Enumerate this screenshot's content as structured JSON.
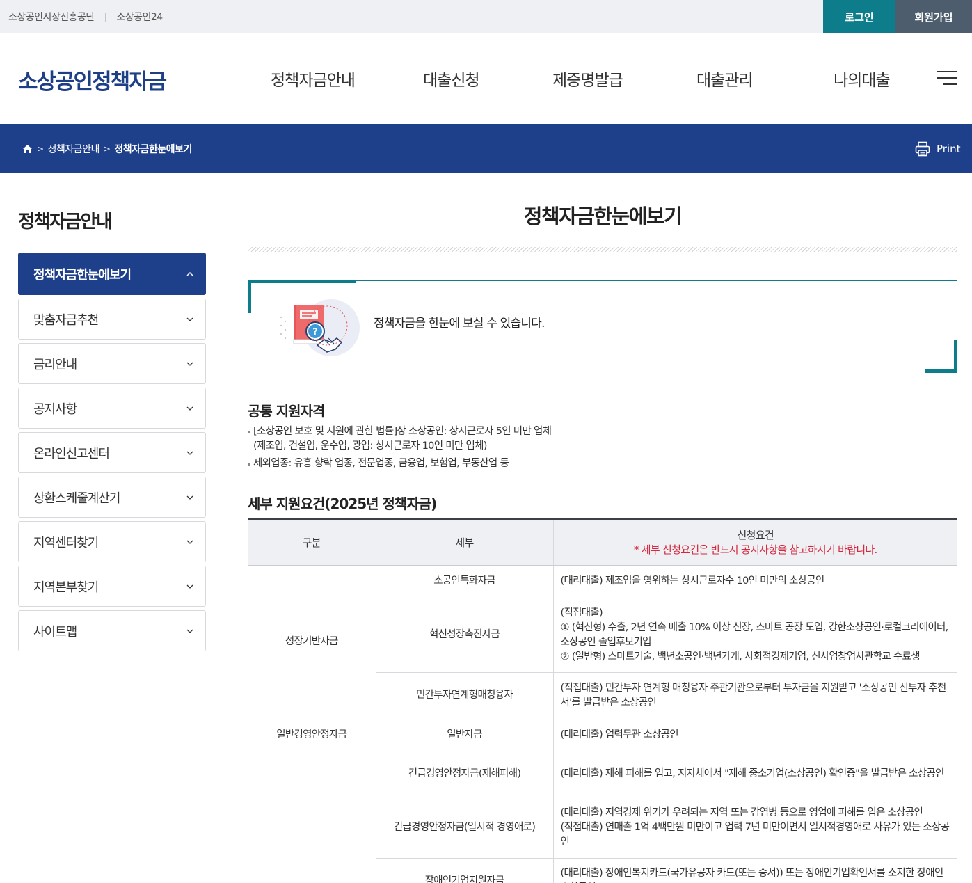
{
  "topbar": {
    "link1": "소상공인시장진흥공단",
    "sep": "|",
    "link2": "소상공인24",
    "login": "로그인",
    "join": "회원가입"
  },
  "header": {
    "logo": "소상공인정책자금",
    "gnb": [
      "정책자금안내",
      "대출신청",
      "제증명발급",
      "대출관리",
      "나의대출"
    ],
    "menu_icon": "hamburger-menu-icon"
  },
  "breadcrumb": {
    "home_icon": "home-icon",
    "level1": "정책자금안내",
    "current": "정책자금한눈에보기",
    "print": "Print"
  },
  "sidebar": {
    "title": "정책자금안내",
    "items": [
      {
        "label": "정책자금한눈에보기",
        "active": true
      },
      {
        "label": "맞춤자금추천"
      },
      {
        "label": "금리안내"
      },
      {
        "label": "공지사항"
      },
      {
        "label": "온라인신고센터"
      },
      {
        "label": "상환스케줄계산기"
      },
      {
        "label": "지역센터찾기"
      },
      {
        "label": "지역본부찾기"
      },
      {
        "label": "사이트맵"
      }
    ]
  },
  "main": {
    "title": "정책자금한눈에보기",
    "intro": "정책자금을 한눈에 보실 수 있습니다.",
    "common": {
      "title": "공통 지원자격",
      "line1": "[소상공인 보호 및 지원에 관한 법률]상 소상공인: 상시근로자 5인 미만 업체",
      "line1b": "(제조업, 건설업, 운수업, 광업: 상시근로자 10인 미만 업체)",
      "line2": "제외업종: 유흥 향락 업종, 전문업종, 금융업, 보험업, 부동산업 등"
    },
    "detail": {
      "title": "세부 지원요건(2025년 정책자금)",
      "headers": {
        "col1": "구분",
        "col2": "세부",
        "col3": "신청요건",
        "col3_note": "* 세부 신청요건은 반드시 공지사항을 참고하시기 바랍니다."
      },
      "rows": [
        {
          "group": "성장기반자금",
          "sub": "소공인특화자금",
          "req": "(대리대출) 제조업을 영위하는 상시근로자수 10인 미만의 소상공인"
        },
        {
          "sub": "혁신성장촉진자금",
          "req": "(직접대출)\n① (혁신형) 수출, 2년 연속 매출 10% 이상 신장, 스마트 공장 도입, 강한소상공인·로컬크리에이터, 소상공인 졸업후보기업\n② (일반형) 스마트기술, 백년소공인·백년가게, 사회적경제기업, 신사업창업사관학교 수료생"
        },
        {
          "sub": "민간투자연계형매칭융자",
          "req": "(직접대출) 민간투자 연계형 매칭융자 주관기관으로부터 투자금을 지원받고 '소상공인 선투자 추천서'를 발급받은 소상공인"
        },
        {
          "group": "일반경영안정자금",
          "sub": "일반자금",
          "req": "(대리대출) 업력무관 소상공인"
        },
        {
          "sub": "긴급경영안정자금(재해피해)",
          "req": "(대리대출) 재해 피해를 입고, 지자체에서 \"재해 중소기업(소상공인) 확인증\"을 발급받은 소상공인"
        },
        {
          "sub": "긴급경영안정자금(일시적 경영애로)",
          "req": "(대리대출) 지역경제 위기가 우려되는 지역 또는 감염병 등으로 영업에 피해를 입은 소상공인\n(직접대출) 연매출 1억 4백만원 미만이고 업력 7년 미만이면서 일시적경영애로 사유가 있는 소상공인"
        },
        {
          "sub": "장애인기업지원자금",
          "req": "(대리대출) 장애인복지카드(국가유공자 카드(또는 증서)) 또는 장애인기업확인서를 소지한 장애인 소상공인"
        }
      ]
    }
  }
}
